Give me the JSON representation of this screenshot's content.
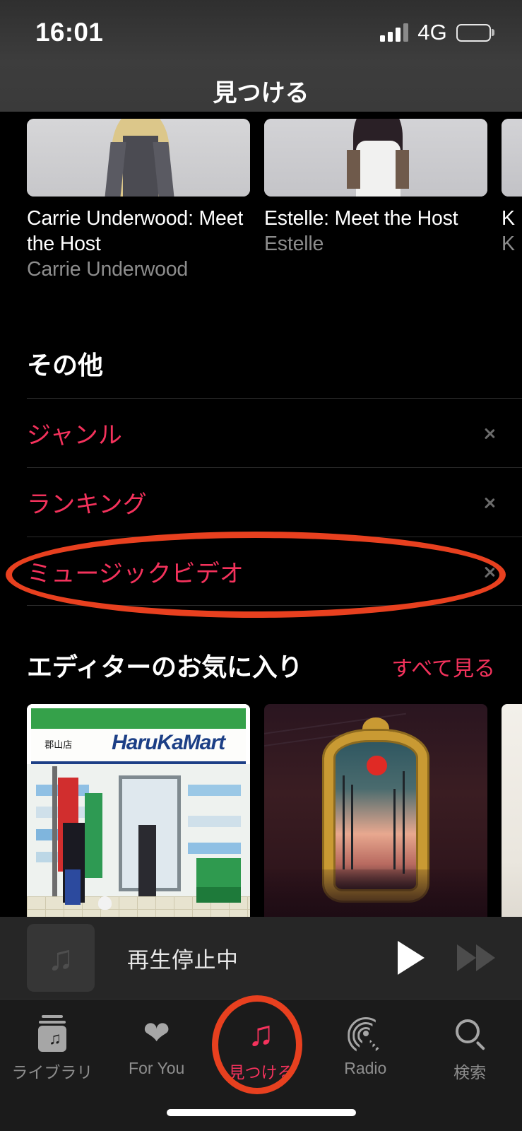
{
  "status_bar": {
    "time": "16:01",
    "carrier": "4G",
    "signal_icon": "signal-bars-icon",
    "battery_icon": "battery-full-icon"
  },
  "nav": {
    "title": "見つける"
  },
  "video_row": {
    "cards": [
      {
        "title": "Carrie Underwood: Meet the Host",
        "artist": "Carrie Underwood"
      },
      {
        "title": "Estelle: Meet the Host",
        "artist": "Estelle"
      },
      {
        "title": "K",
        "artist": "K"
      }
    ]
  },
  "other_section": {
    "heading": "その他",
    "items": [
      {
        "label": "ジャンル",
        "chevron": "chevron-right-icon"
      },
      {
        "label": "ランキング",
        "chevron": "chevron-right-icon"
      },
      {
        "label": "ミュージックビデオ",
        "chevron": "chevron-right-icon"
      }
    ]
  },
  "editor_section": {
    "heading": "エディターのお気に入り",
    "see_all": "すべて見る",
    "albums": [
      {
        "art_label": "HaruKaMart",
        "art_sub": "郡山店"
      },
      {
        "art_label": "",
        "art_sub": ""
      },
      {
        "art_label": "",
        "art_sub": ""
      }
    ]
  },
  "mini_player": {
    "artwork_icon": "music-note-icon",
    "status_text": "再生停止中",
    "play_icon": "play-icon",
    "forward_icon": "fast-forward-icon"
  },
  "tab_bar": {
    "tabs": [
      {
        "label": "ライブラリ",
        "icon": "library-icon",
        "active": false
      },
      {
        "label": "For You",
        "icon": "heart-icon",
        "active": false
      },
      {
        "label": "見つける",
        "icon": "music-note-icon",
        "active": true
      },
      {
        "label": "Radio",
        "icon": "radio-waves-icon",
        "active": false
      },
      {
        "label": "検索",
        "icon": "search-icon",
        "active": false
      }
    ]
  },
  "colors": {
    "accent_pink": "#f4325c",
    "annotation_red": "#e8401f",
    "background": "#000000",
    "nav_bar": "#3a3a3a",
    "tab_bar": "#1b1b1b"
  }
}
